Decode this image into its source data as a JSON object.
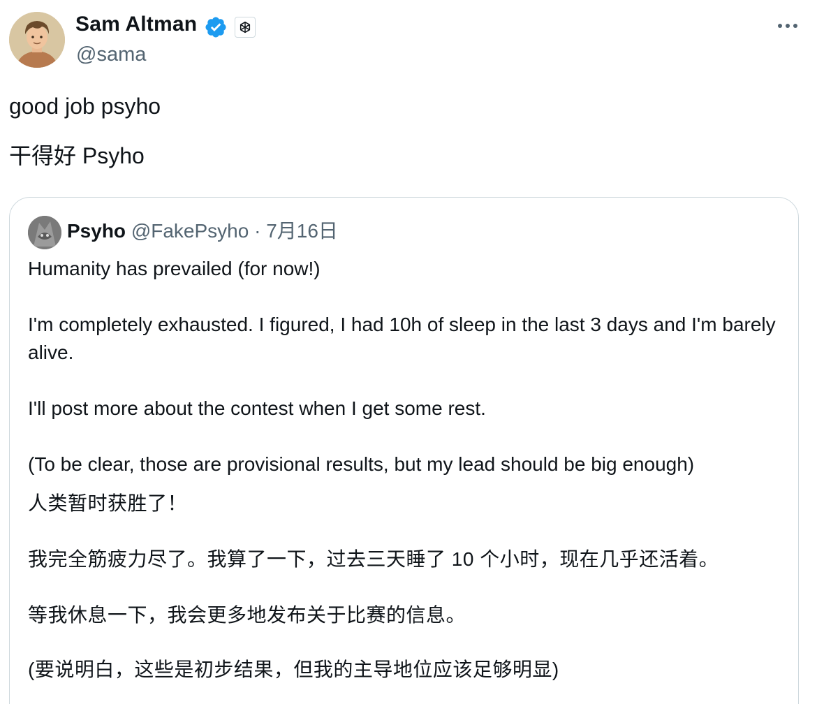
{
  "tweet": {
    "author": {
      "display_name": "Sam Altman",
      "handle": "@sama",
      "verified": true,
      "verified_color": "#1d9bf0",
      "affiliate_badge": "openai-logo-icon"
    },
    "more_icon": "more-horizontal-icon",
    "text_lines": [
      "good job psyho",
      "干得好 Psyho"
    ]
  },
  "quoted_tweet": {
    "author": {
      "display_name": "Psyho",
      "handle": "@FakePsyho",
      "separator": "·",
      "date": "7月16日"
    },
    "paragraphs": [
      "Humanity has prevailed (for now!)",
      "I'm completely exhausted. I figured, I had 10h of sleep in the last 3 days and I'm barely alive.",
      "I'll post more about the contest when I get some rest.",
      "(To be clear, those are provisional results, but my lead should be big enough)",
      "人类暂时获胜了！",
      "我完全筋疲力尽了。我算了一下，过去三天睡了 10 个小时，现在几乎还活着。",
      "等我休息一下，我会更多地发布关于比赛的信息。",
      "(要说明白，这些是初步结果，但我的主导地位应该足够明显)"
    ]
  },
  "colors": {
    "text_primary": "#0f1419",
    "text_secondary": "#536471",
    "border": "#cfd9de"
  }
}
